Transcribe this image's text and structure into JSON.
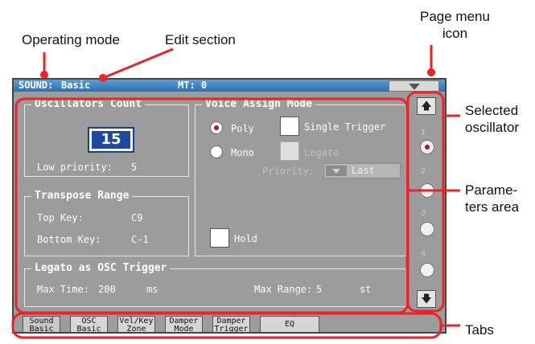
{
  "annotations": {
    "operating_mode": "Operating mode",
    "edit_section": "Edit section",
    "page_menu_icon": "Page menu\nicon",
    "selected_oscillator": "Selected\noscillator",
    "parameters_area": "Parame-\nters area",
    "tabs": "Tabs"
  },
  "header": {
    "mode": "SOUND:",
    "section": "Basic",
    "mt": "MT: 0"
  },
  "oscillators_count": {
    "title": "Oscillators Count",
    "value": "15",
    "low_priority_label": "Low priority:",
    "low_priority_value": "5"
  },
  "transpose_range": {
    "title": "Transpose Range",
    "top_key_label": "Top Key:",
    "top_key_value": "C9",
    "bottom_key_label": "Bottom Key:",
    "bottom_key_value": "C-1"
  },
  "voice_assign": {
    "title": "Voice Assign Mode",
    "poly": "Poly",
    "mono": "Mono",
    "single_trigger": "Single Trigger",
    "legato": "Legato",
    "priority_label": "Priority:",
    "priority_value": "Last",
    "hold": "Hold"
  },
  "legato_trigger": {
    "title": "Legato as OSC Trigger",
    "max_time_label": "Max Time:",
    "max_time_value": "200",
    "max_time_unit": "ms",
    "max_range_label": "Max Range:",
    "max_range_value": "5",
    "max_range_unit": "st"
  },
  "oscillator_panel": {
    "numbers": [
      "1",
      "2",
      "3",
      "4"
    ],
    "selected": "1"
  },
  "tabs": [
    "Sound\nBasic",
    "OSC\nBasic",
    "Vel/Key\nZone",
    "Damper\nMode",
    "Damper\nTrigger",
    "EQ"
  ],
  "colors": {
    "title_bar": "#3a7fc4",
    "highlight": "#e8232a",
    "selected_value": "#1d4a9e",
    "panel_bg": "#9c9c9c"
  }
}
